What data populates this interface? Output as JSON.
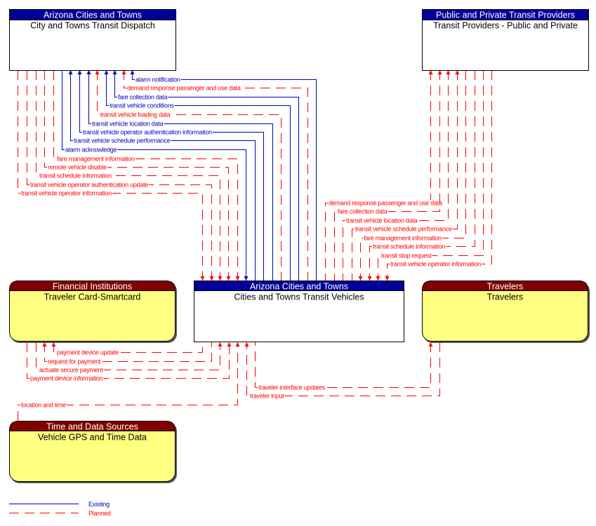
{
  "diagram": {
    "colors": {
      "existing": "#0000c0",
      "planned": "#ff0000",
      "center_header": "#000099",
      "terminator_header": "#800000",
      "terminator_fill": "#ffff80",
      "center_fill": "#ffffff"
    },
    "elements": {
      "dispatch": {
        "header": "Arizona Cities and Towns",
        "name": "City and Towns Transit Dispatch",
        "kind": "center"
      },
      "providers": {
        "header": "Public and Private Transit Providers",
        "name": "Transit Providers - Public and Private",
        "kind": "center"
      },
      "vehicles": {
        "header": "Arizona Cities and Towns",
        "name": "Cities and Towns Transit Vehicles",
        "kind": "center"
      },
      "financial": {
        "header": "Financial Institutions",
        "name": "Traveler Card-Smartcard",
        "kind": "terminator"
      },
      "travelers": {
        "header": "Travelers",
        "name": "Travelers",
        "kind": "terminator"
      },
      "gps": {
        "header": "Time and Data Sources",
        "name": "Vehicle GPS and Time Data",
        "kind": "terminator"
      }
    },
    "flows": [
      {
        "label": "alarm notification",
        "status": "existing",
        "from": "vehicles",
        "to": "dispatch"
      },
      {
        "label": "demand response passenger and use data",
        "status": "planned",
        "from": "vehicles",
        "to": "dispatch"
      },
      {
        "label": "fare collection data",
        "status": "existing",
        "from": "vehicles",
        "to": "dispatch"
      },
      {
        "label": "transit vehicle conditions",
        "status": "existing",
        "from": "vehicles",
        "to": "dispatch"
      },
      {
        "label": "transit vehicle loading data",
        "status": "planned",
        "from": "vehicles",
        "to": "dispatch"
      },
      {
        "label": "transit vehicle location data",
        "status": "existing",
        "from": "vehicles",
        "to": "dispatch"
      },
      {
        "label": "transit vehicle operator authentication information",
        "status": "existing",
        "from": "vehicles",
        "to": "dispatch"
      },
      {
        "label": "transit vehicle schedule performance",
        "status": "existing",
        "from": "vehicles",
        "to": "dispatch"
      },
      {
        "label": "alarm acknowledge",
        "status": "existing",
        "from": "dispatch",
        "to": "vehicles"
      },
      {
        "label": "fare management information",
        "status": "planned",
        "from": "dispatch",
        "to": "vehicles"
      },
      {
        "label": "remote vehicle disable",
        "status": "planned",
        "from": "dispatch",
        "to": "vehicles"
      },
      {
        "label": "transit schedule information",
        "status": "planned",
        "from": "dispatch",
        "to": "vehicles"
      },
      {
        "label": "transit vehicle operator authentication update",
        "status": "planned",
        "from": "dispatch",
        "to": "vehicles"
      },
      {
        "label": "transit vehicle operator information",
        "status": "planned",
        "from": "dispatch",
        "to": "vehicles"
      },
      {
        "label": "demand response passenger and use data",
        "status": "planned",
        "from": "vehicles",
        "to": "providers"
      },
      {
        "label": "fare collection data",
        "status": "planned",
        "from": "vehicles",
        "to": "providers"
      },
      {
        "label": "transit vehicle location data",
        "status": "planned",
        "from": "vehicles",
        "to": "providers"
      },
      {
        "label": "transit vehicle schedule performance",
        "status": "planned",
        "from": "vehicles",
        "to": "providers"
      },
      {
        "label": "fare management information",
        "status": "planned",
        "from": "providers",
        "to": "vehicles"
      },
      {
        "label": "transit schedule information",
        "status": "planned",
        "from": "providers",
        "to": "vehicles"
      },
      {
        "label": "transit stop request",
        "status": "planned",
        "from": "providers",
        "to": "vehicles"
      },
      {
        "label": "transit vehicle operator information",
        "status": "planned",
        "from": "providers",
        "to": "vehicles"
      },
      {
        "label": "payment device update",
        "status": "planned",
        "from": "vehicles",
        "to": "financial"
      },
      {
        "label": "request for payment",
        "status": "planned",
        "from": "vehicles",
        "to": "financial"
      },
      {
        "label": "actuate secure payment",
        "status": "planned",
        "from": "financial",
        "to": "vehicles"
      },
      {
        "label": "payment device information",
        "status": "planned",
        "from": "financial",
        "to": "vehicles"
      },
      {
        "label": "location and time",
        "status": "planned",
        "from": "gps",
        "to": "vehicles"
      },
      {
        "label": "traveler interface updates",
        "status": "planned",
        "from": "vehicles",
        "to": "travelers"
      },
      {
        "label": "traveler input",
        "status": "planned",
        "from": "travelers",
        "to": "vehicles"
      }
    ],
    "legend": {
      "existing": "Existing",
      "planned": "Planned"
    }
  }
}
